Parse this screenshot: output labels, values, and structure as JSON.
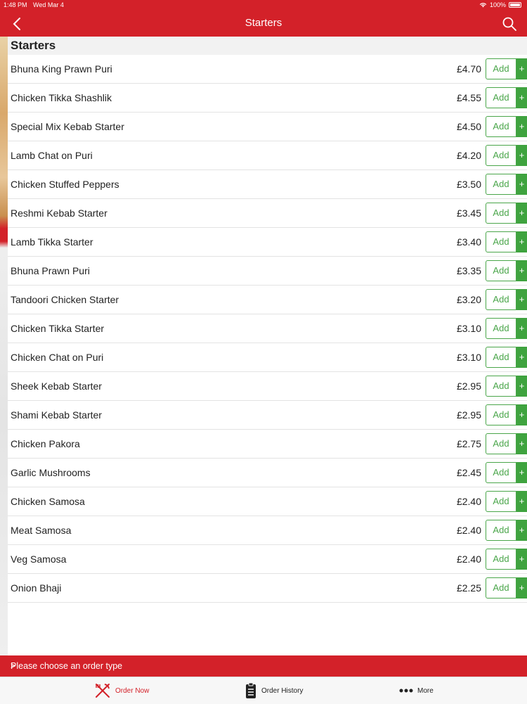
{
  "status_bar": {
    "time": "1:48 PM",
    "date": "Wed Mar 4",
    "battery": "100%"
  },
  "nav": {
    "title": "Starters"
  },
  "section": {
    "title": "Starters"
  },
  "items": [
    {
      "name": "Bhuna King Prawn Puri",
      "price": "£4.70"
    },
    {
      "name": "Chicken Tikka Shashlik",
      "price": "£4.55"
    },
    {
      "name": "Special Mix Kebab Starter",
      "price": "£4.50"
    },
    {
      "name": "Lamb Chat on Puri",
      "price": "£4.20"
    },
    {
      "name": "Chicken Stuffed Peppers",
      "price": "£3.50"
    },
    {
      "name": "Reshmi Kebab Starter",
      "price": "£3.45"
    },
    {
      "name": "Lamb Tikka Starter",
      "price": "£3.40"
    },
    {
      "name": "Bhuna Prawn Puri",
      "price": "£3.35"
    },
    {
      "name": "Tandoori Chicken Starter",
      "price": "£3.20"
    },
    {
      "name": "Chicken Tikka Starter",
      "price": "£3.10"
    },
    {
      "name": "Chicken Chat on Puri",
      "price": "£3.10"
    },
    {
      "name": "Sheek Kebab Starter",
      "price": "£2.95"
    },
    {
      "name": "Shami Kebab Starter",
      "price": "£2.95"
    },
    {
      "name": "Chicken Pakora",
      "price": "£2.75"
    },
    {
      "name": "Garlic Mushrooms",
      "price": "£2.45"
    },
    {
      "name": "Chicken Samosa",
      "price": "£2.40"
    },
    {
      "name": "Meat Samosa",
      "price": "£2.40"
    },
    {
      "name": "Veg Samosa",
      "price": "£2.40"
    },
    {
      "name": "Onion Bhaji",
      "price": "£2.25"
    }
  ],
  "add_label": "Add",
  "plus_label": "+",
  "order_bar": {
    "text": "Please choose an order type",
    "chevron": ">"
  },
  "tabs": {
    "order_now": "Order Now",
    "order_history": "Order History",
    "more": "More"
  },
  "colors": {
    "brand_red": "#d32129",
    "add_green": "#4aa64a"
  }
}
